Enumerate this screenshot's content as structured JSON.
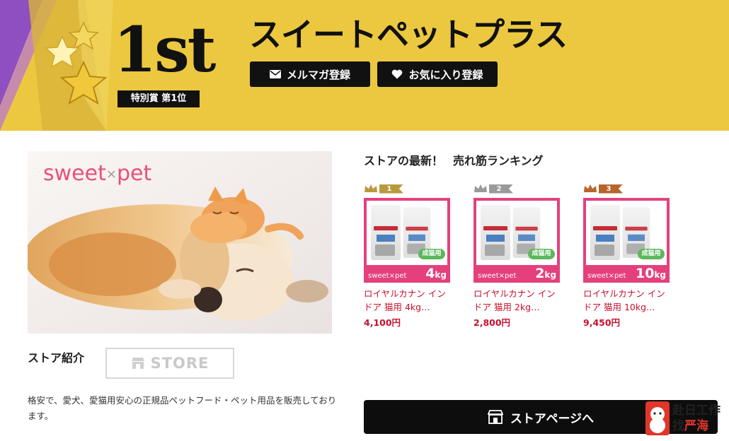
{
  "banner": {
    "rank": "1st",
    "rank_sub": "特別賞 第1位",
    "store_name": "スイートペットプラス",
    "mail_button": "メルマガ登録",
    "fav_button": "お気に入り登録"
  },
  "hero": {
    "logo_left": "sweet",
    "logo_x": "×",
    "logo_right": "pet"
  },
  "intro": {
    "heading": "ストア紹介",
    "store_badge": "STORE",
    "description": "格安で、愛犬、愛猫用安心の正規品ペットフード・ペット用品を販売しております。"
  },
  "ranking": {
    "heading_part1": "ストアの最新！",
    "heading_part2": "売れ筋ランキング",
    "items": [
      {
        "rank": "1",
        "rank_color": "#b89a3e",
        "name": "ロイヤルカナン インドア 猫用 4kg…",
        "price": "4,100円",
        "weight": "4",
        "unit": "kg",
        "tag": "成猫用",
        "brand": "sweet×pet"
      },
      {
        "rank": "2",
        "rank_color": "#9a9a9a",
        "name": "ロイヤルカナン インドア 猫用 2kg…",
        "price": "2,800円",
        "weight": "2",
        "unit": "kg",
        "tag": "成猫用",
        "brand": "sweet×pet"
      },
      {
        "rank": "3",
        "rank_color": "#b8652b",
        "name": "ロイヤルカナン インドア 猫用 10kg…",
        "price": "9,450円",
        "weight": "10",
        "unit": "kg",
        "tag": "成猫用",
        "brand": "sweet×pet"
      }
    ]
  },
  "store_page_button": "ストアページへ",
  "watermark": {
    "line1": "赴日工作",
    "line2_a": "找",
    "line2_b": "严海"
  },
  "colors": {
    "banner_bg": "#ecc840",
    "price_red": "#c8102e",
    "product_pink": "#e4407d"
  }
}
